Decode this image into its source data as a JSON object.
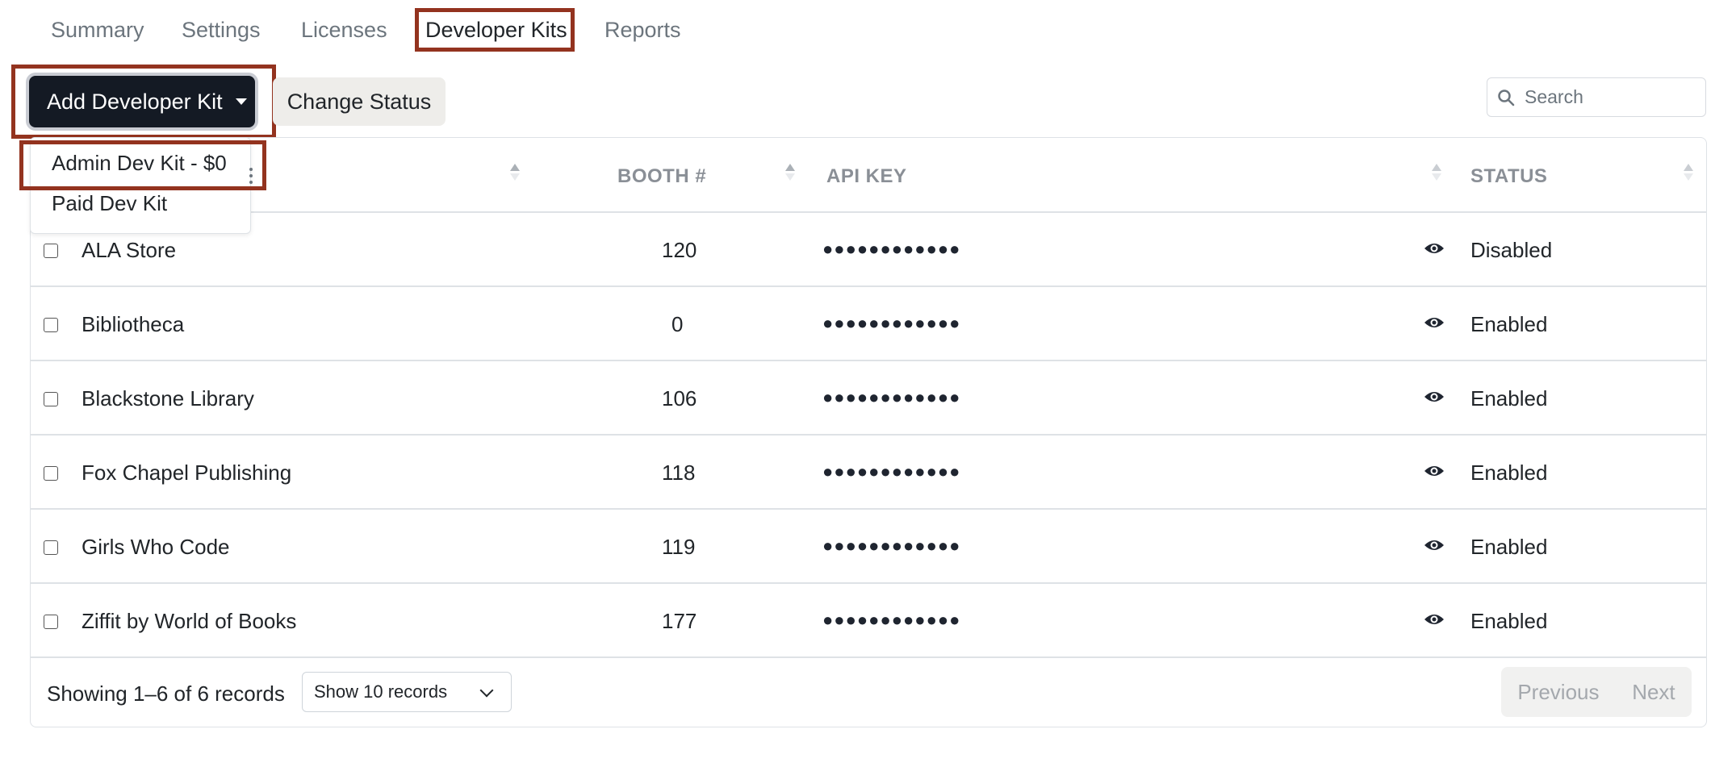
{
  "tabs": [
    "Summary",
    "Settings",
    "Licenses",
    "Developer Kits",
    "Reports"
  ],
  "active_tab": "Developer Kits",
  "toolbar": {
    "add_label": "Add Developer Kit",
    "change_status_label": "Change Status",
    "search_placeholder": "Search"
  },
  "dropdown": {
    "items": [
      "Admin Dev Kit - $0",
      "Paid Dev Kit"
    ]
  },
  "table": {
    "headers": {
      "booth": "BOOTH #",
      "api_key": "API KEY",
      "status": "STATUS"
    },
    "rows": [
      {
        "name": "ALA Store",
        "booth": "120",
        "api_key": "●●●●●●●●●●●●",
        "status": "Disabled"
      },
      {
        "name": "Bibliotheca",
        "booth": "0",
        "api_key": "●●●●●●●●●●●●",
        "status": "Enabled"
      },
      {
        "name": "Blackstone Library",
        "booth": "106",
        "api_key": "●●●●●●●●●●●●",
        "status": "Enabled"
      },
      {
        "name": "Fox Chapel Publishing",
        "booth": "118",
        "api_key": "●●●●●●●●●●●●",
        "status": "Enabled"
      },
      {
        "name": "Girls Who Code",
        "booth": "119",
        "api_key": "●●●●●●●●●●●●",
        "status": "Enabled"
      },
      {
        "name": "Ziffit by World of Books",
        "booth": "177",
        "api_key": "●●●●●●●●●●●●",
        "status": "Enabled"
      }
    ]
  },
  "footer": {
    "showing": "Showing 1–6 of 6 records",
    "page_size": "Show 10 records",
    "previous": "Previous",
    "next": "Next"
  },
  "colors": {
    "highlight": "#93331f",
    "primary_button": "#141a24"
  }
}
